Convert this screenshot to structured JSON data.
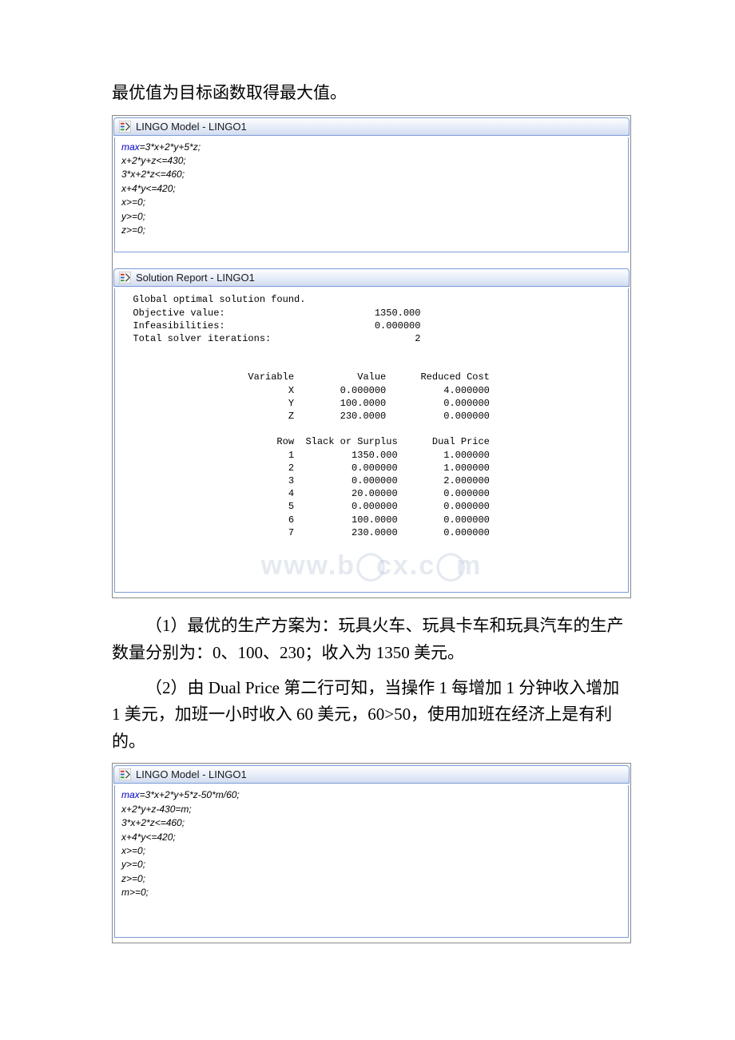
{
  "intro_line": "最优值为目标函数取得最大值。",
  "window1": {
    "title": "LINGO Model - LINGO1",
    "lines": [
      "max=3*x+2*y+5*z;",
      "x+2*y+z<=430;",
      "3*x+2*z<=460;",
      "x+4*y<=420;",
      "x>=0;",
      "y>=0;",
      "z>=0;"
    ]
  },
  "window2": {
    "title": "Solution Report - LINGO1",
    "status": "Global optimal solution found.",
    "summary": [
      {
        "label": "Objective value:",
        "value": "1350.000"
      },
      {
        "label": "Infeasibilities:",
        "value": "0.000000"
      },
      {
        "label": "Total solver iterations:",
        "value": "2"
      }
    ],
    "var_headers": [
      "Variable",
      "Value",
      "Reduced Cost"
    ],
    "var_rows": [
      [
        "X",
        "0.000000",
        "4.000000"
      ],
      [
        "Y",
        "100.0000",
        "0.000000"
      ],
      [
        "Z",
        "230.0000",
        "0.000000"
      ]
    ],
    "row_headers": [
      "Row",
      "Slack or Surplus",
      "Dual Price"
    ],
    "row_rows": [
      [
        "1",
        "1350.000",
        "1.000000"
      ],
      [
        "2",
        "0.000000",
        "1.000000"
      ],
      [
        "3",
        "0.000000",
        "2.000000"
      ],
      [
        "4",
        "20.00000",
        "0.000000"
      ],
      [
        "5",
        "0.000000",
        "0.000000"
      ],
      [
        "6",
        "100.0000",
        "0.000000"
      ],
      [
        "7",
        "230.0000",
        "0.000000"
      ]
    ]
  },
  "para1": "（1）最优的生产方案为：玩具火车、玩具卡车和玩具汽车的生产数量分别为：0、100、230；收入为 1350 美元。",
  "para2": "（2）由 Dual Price 第二行可知，当操作 1 每增加 1 分钟收入增加 1 美元，加班一小时收入 60 美元，60>50，使用加班在经济上是有利的。",
  "window3": {
    "title": "LINGO Model - LINGO1",
    "lines": [
      "max=3*x+2*y+5*z-50*m/60;",
      "x+2*y+z-430=m;",
      "3*x+2*z<=460;",
      "x+4*y<=420;",
      "x>=0;",
      "y>=0;",
      "z>=0;",
      "m>=0;"
    ]
  },
  "watermark": "www.docx.com"
}
